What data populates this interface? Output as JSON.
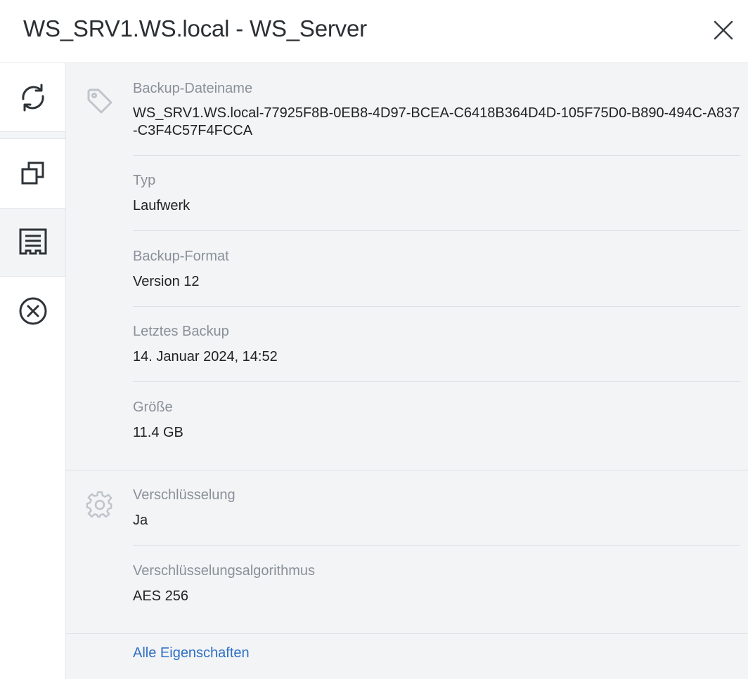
{
  "header": {
    "title": "WS_SRV1.WS.local - WS_Server",
    "close_icon": "close-icon"
  },
  "sidebar": {
    "items": [
      {
        "icon": "refresh-icon",
        "active": false
      },
      {
        "icon": "copy-icon",
        "active": true
      },
      {
        "icon": "details-list-icon",
        "active": true
      },
      {
        "icon": "cancel-circle-icon",
        "active": false
      }
    ]
  },
  "sections": {
    "general": {
      "icon": "tag-icon",
      "properties": [
        {
          "label": "Backup-Dateiname",
          "value": "WS_SRV1.WS.local-77925F8B-0EB8-4D97-BCEA-C6418B364D4D-105F75D0-B890-494C-A837-C3F4C57F4FCCA"
        },
        {
          "label": "Typ",
          "value": "Laufwerk"
        },
        {
          "label": "Backup-Format",
          "value": "Version 12"
        },
        {
          "label": "Letztes Backup",
          "value": "14. Januar 2024, 14:52"
        },
        {
          "label": "Größe",
          "value": "11.4 GB"
        }
      ]
    },
    "encryption": {
      "icon": "gear-icon",
      "properties": [
        {
          "label": "Verschlüsselung",
          "value": "Ja"
        },
        {
          "label": "Verschlüsselungsalgorithmus",
          "value": "AES 256"
        }
      ]
    }
  },
  "footer": {
    "all_properties_link": "Alle Eigenschaften"
  },
  "colors": {
    "accent_link": "#2f6fc4",
    "icon_gray": "#c0c5cb",
    "icon_dark": "#2e3338",
    "panel_bg": "#f2f4f6"
  }
}
